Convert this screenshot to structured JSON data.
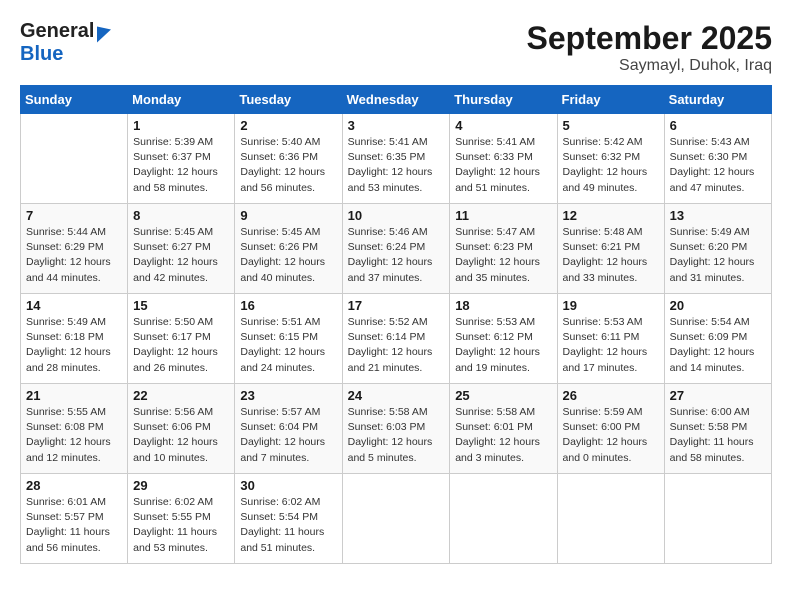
{
  "header": {
    "logo_general": "General",
    "logo_blue": "Blue",
    "month_title": "September 2025",
    "location": "Saymayl, Duhok, Iraq"
  },
  "weekdays": [
    "Sunday",
    "Monday",
    "Tuesday",
    "Wednesday",
    "Thursday",
    "Friday",
    "Saturday"
  ],
  "weeks": [
    [
      {
        "day": "",
        "sunrise": "",
        "sunset": "",
        "daylight": ""
      },
      {
        "day": "1",
        "sunrise": "Sunrise: 5:39 AM",
        "sunset": "Sunset: 6:37 PM",
        "daylight": "Daylight: 12 hours and 58 minutes."
      },
      {
        "day": "2",
        "sunrise": "Sunrise: 5:40 AM",
        "sunset": "Sunset: 6:36 PM",
        "daylight": "Daylight: 12 hours and 56 minutes."
      },
      {
        "day": "3",
        "sunrise": "Sunrise: 5:41 AM",
        "sunset": "Sunset: 6:35 PM",
        "daylight": "Daylight: 12 hours and 53 minutes."
      },
      {
        "day": "4",
        "sunrise": "Sunrise: 5:41 AM",
        "sunset": "Sunset: 6:33 PM",
        "daylight": "Daylight: 12 hours and 51 minutes."
      },
      {
        "day": "5",
        "sunrise": "Sunrise: 5:42 AM",
        "sunset": "Sunset: 6:32 PM",
        "daylight": "Daylight: 12 hours and 49 minutes."
      },
      {
        "day": "6",
        "sunrise": "Sunrise: 5:43 AM",
        "sunset": "Sunset: 6:30 PM",
        "daylight": "Daylight: 12 hours and 47 minutes."
      }
    ],
    [
      {
        "day": "7",
        "sunrise": "Sunrise: 5:44 AM",
        "sunset": "Sunset: 6:29 PM",
        "daylight": "Daylight: 12 hours and 44 minutes."
      },
      {
        "day": "8",
        "sunrise": "Sunrise: 5:45 AM",
        "sunset": "Sunset: 6:27 PM",
        "daylight": "Daylight: 12 hours and 42 minutes."
      },
      {
        "day": "9",
        "sunrise": "Sunrise: 5:45 AM",
        "sunset": "Sunset: 6:26 PM",
        "daylight": "Daylight: 12 hours and 40 minutes."
      },
      {
        "day": "10",
        "sunrise": "Sunrise: 5:46 AM",
        "sunset": "Sunset: 6:24 PM",
        "daylight": "Daylight: 12 hours and 37 minutes."
      },
      {
        "day": "11",
        "sunrise": "Sunrise: 5:47 AM",
        "sunset": "Sunset: 6:23 PM",
        "daylight": "Daylight: 12 hours and 35 minutes."
      },
      {
        "day": "12",
        "sunrise": "Sunrise: 5:48 AM",
        "sunset": "Sunset: 6:21 PM",
        "daylight": "Daylight: 12 hours and 33 minutes."
      },
      {
        "day": "13",
        "sunrise": "Sunrise: 5:49 AM",
        "sunset": "Sunset: 6:20 PM",
        "daylight": "Daylight: 12 hours and 31 minutes."
      }
    ],
    [
      {
        "day": "14",
        "sunrise": "Sunrise: 5:49 AM",
        "sunset": "Sunset: 6:18 PM",
        "daylight": "Daylight: 12 hours and 28 minutes."
      },
      {
        "day": "15",
        "sunrise": "Sunrise: 5:50 AM",
        "sunset": "Sunset: 6:17 PM",
        "daylight": "Daylight: 12 hours and 26 minutes."
      },
      {
        "day": "16",
        "sunrise": "Sunrise: 5:51 AM",
        "sunset": "Sunset: 6:15 PM",
        "daylight": "Daylight: 12 hours and 24 minutes."
      },
      {
        "day": "17",
        "sunrise": "Sunrise: 5:52 AM",
        "sunset": "Sunset: 6:14 PM",
        "daylight": "Daylight: 12 hours and 21 minutes."
      },
      {
        "day": "18",
        "sunrise": "Sunrise: 5:53 AM",
        "sunset": "Sunset: 6:12 PM",
        "daylight": "Daylight: 12 hours and 19 minutes."
      },
      {
        "day": "19",
        "sunrise": "Sunrise: 5:53 AM",
        "sunset": "Sunset: 6:11 PM",
        "daylight": "Daylight: 12 hours and 17 minutes."
      },
      {
        "day": "20",
        "sunrise": "Sunrise: 5:54 AM",
        "sunset": "Sunset: 6:09 PM",
        "daylight": "Daylight: 12 hours and 14 minutes."
      }
    ],
    [
      {
        "day": "21",
        "sunrise": "Sunrise: 5:55 AM",
        "sunset": "Sunset: 6:08 PM",
        "daylight": "Daylight: 12 hours and 12 minutes."
      },
      {
        "day": "22",
        "sunrise": "Sunrise: 5:56 AM",
        "sunset": "Sunset: 6:06 PM",
        "daylight": "Daylight: 12 hours and 10 minutes."
      },
      {
        "day": "23",
        "sunrise": "Sunrise: 5:57 AM",
        "sunset": "Sunset: 6:04 PM",
        "daylight": "Daylight: 12 hours and 7 minutes."
      },
      {
        "day": "24",
        "sunrise": "Sunrise: 5:58 AM",
        "sunset": "Sunset: 6:03 PM",
        "daylight": "Daylight: 12 hours and 5 minutes."
      },
      {
        "day": "25",
        "sunrise": "Sunrise: 5:58 AM",
        "sunset": "Sunset: 6:01 PM",
        "daylight": "Daylight: 12 hours and 3 minutes."
      },
      {
        "day": "26",
        "sunrise": "Sunrise: 5:59 AM",
        "sunset": "Sunset: 6:00 PM",
        "daylight": "Daylight: 12 hours and 0 minutes."
      },
      {
        "day": "27",
        "sunrise": "Sunrise: 6:00 AM",
        "sunset": "Sunset: 5:58 PM",
        "daylight": "Daylight: 11 hours and 58 minutes."
      }
    ],
    [
      {
        "day": "28",
        "sunrise": "Sunrise: 6:01 AM",
        "sunset": "Sunset: 5:57 PM",
        "daylight": "Daylight: 11 hours and 56 minutes."
      },
      {
        "day": "29",
        "sunrise": "Sunrise: 6:02 AM",
        "sunset": "Sunset: 5:55 PM",
        "daylight": "Daylight: 11 hours and 53 minutes."
      },
      {
        "day": "30",
        "sunrise": "Sunrise: 6:02 AM",
        "sunset": "Sunset: 5:54 PM",
        "daylight": "Daylight: 11 hours and 51 minutes."
      },
      {
        "day": "",
        "sunrise": "",
        "sunset": "",
        "daylight": ""
      },
      {
        "day": "",
        "sunrise": "",
        "sunset": "",
        "daylight": ""
      },
      {
        "day": "",
        "sunrise": "",
        "sunset": "",
        "daylight": ""
      },
      {
        "day": "",
        "sunrise": "",
        "sunset": "",
        "daylight": ""
      }
    ]
  ]
}
